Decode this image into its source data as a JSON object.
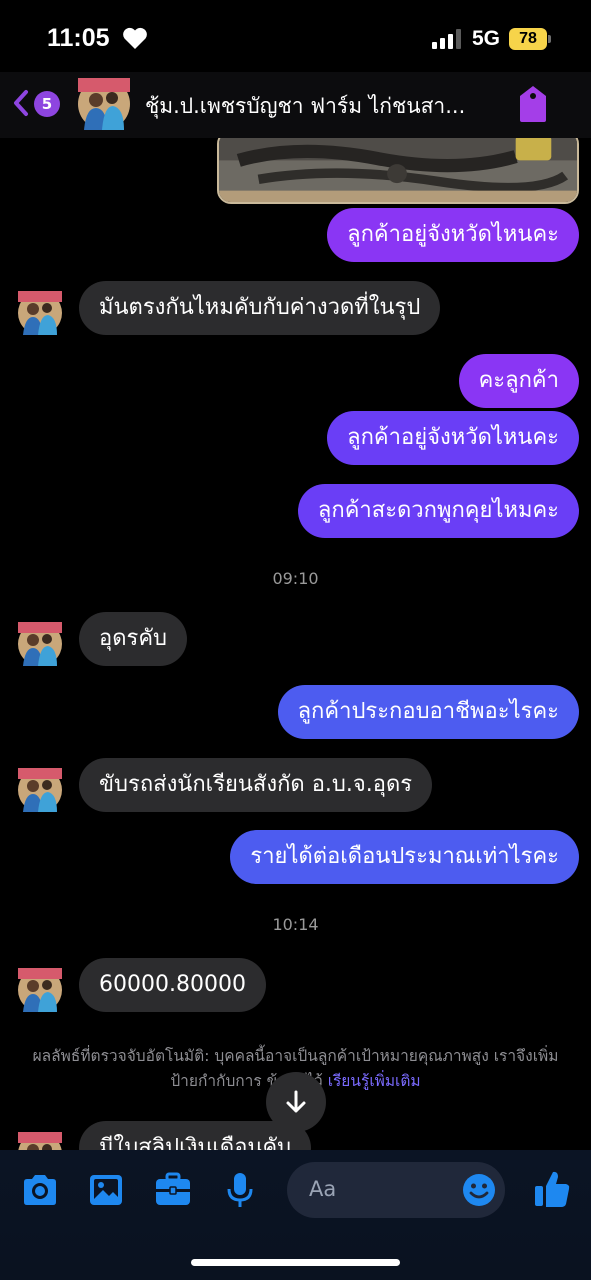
{
  "status_bar": {
    "time": "11:05",
    "network": "5G",
    "battery": "78"
  },
  "header": {
    "back_count": "5",
    "title": "ชุ้ม.ป.เพชรบัญชา ฟาร์ม ไก่ชนสา..."
  },
  "messages": [
    {
      "dir": "out",
      "text": "ลูกค้าอยู่จังหวัดไหนคะ"
    },
    {
      "dir": "in",
      "text": "มันตรงกันไหมคับกับค่างวดที่ในรุป"
    },
    {
      "dir": "out",
      "text": "คะลูกค้า"
    },
    {
      "dir": "out",
      "text": "ลูกค้าอยู่จังหวัดไหนคะ"
    },
    {
      "dir": "out",
      "text": "ลูกค้าสะดวกพูกคุยไหมคะ"
    },
    {
      "dir": "in",
      "text": "อุดรคับ"
    },
    {
      "dir": "out",
      "text": "ลูกค้าประกอบอาชีพอะไรคะ"
    },
    {
      "dir": "in",
      "text": "ขับรถส่งนักเรียนสังกัด อ.บ.จ.อุดร"
    },
    {
      "dir": "out",
      "text": "รายได้ต่อเดือนประมาณเท่าไรคะ"
    },
    {
      "dir": "in",
      "text": "60000.80000"
    },
    {
      "dir": "in",
      "text": "มีใบสลิปเงินเดือนคับ"
    }
  ],
  "timestamps": [
    "09:10",
    "10:14"
  ],
  "notice": {
    "text": "ผลลัพธ์ที่ตรวจจับอัตโนมัติ: บุคคลนี้อาจเป็นลูกค้าเป้าหมายคุณภาพสูง เราจึงเพิ่มป้ายกำกับการ ข้อมูลไว้",
    "link": "เรียนรู้เพิ่มเติม"
  },
  "composer": {
    "placeholder": "Aa"
  },
  "colors": {
    "accent": "#8e45e0",
    "bubble_out_purple": "#8a36f4",
    "bubble_out_violet": "#6a3ef6",
    "bubble_out_blue": "#4d5cf0",
    "bubble_in": "#2c2c2e",
    "link": "#7b6bff",
    "icon_blue": "#1e88f0"
  },
  "icons": [
    "camera-icon",
    "image-icon",
    "toolbox-icon",
    "microphone-icon",
    "emoji-icon",
    "thumbs-up-icon",
    "arrow-down-icon",
    "tag-icon",
    "back-chevron-icon"
  ]
}
